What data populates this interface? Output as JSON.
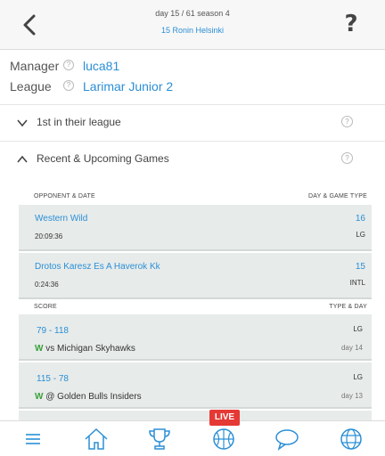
{
  "header": {
    "day_info": "day 15 / 61 season 4",
    "team_name": "15 Ronin Helsinki",
    "back_icon": "chevron-left-icon",
    "help_label": "?"
  },
  "info": {
    "manager_label": "Manager",
    "manager_value": "luca81",
    "league_label": "League",
    "league_value": "Larimar Junior 2",
    "q": "?"
  },
  "sections": [
    {
      "label": "1st in their league",
      "expanded": false
    },
    {
      "label": "Recent & Upcoming Games",
      "expanded": true
    }
  ],
  "upcoming": {
    "col_left": "OPPONENT & DATE",
    "col_right": "DAY & GAME TYPE",
    "games": [
      {
        "opponent": "Western Wild",
        "time": "20:09:36",
        "day": "16",
        "type": "LG"
      },
      {
        "opponent": "Drotos Karesz Es A Haverok Kk",
        "time": "0:24:36",
        "day": "15",
        "type": "INTL"
      }
    ]
  },
  "results": {
    "col_left": "SCORE",
    "col_right": "TYPE & DAY",
    "games": [
      {
        "score": "79 - 118",
        "result": "W",
        "venue": "vs",
        "opponent": "Michigan Skyhawks",
        "type": "LG",
        "day": "day 14"
      },
      {
        "score": "115 - 78",
        "result": "W",
        "venue": "@",
        "opponent": "Golden Bulls Insiders",
        "type": "LG",
        "day": "day 13"
      }
    ]
  },
  "nav": {
    "items": [
      "menu-icon",
      "home-icon",
      "trophy-icon",
      "basketball-icon",
      "chat-icon",
      "globe-icon"
    ],
    "live_label": "LIVE"
  },
  "colors": {
    "accent": "#2b8fd6",
    "win": "#3aa03a",
    "live": "#e53935",
    "card": "#e7ebea"
  }
}
